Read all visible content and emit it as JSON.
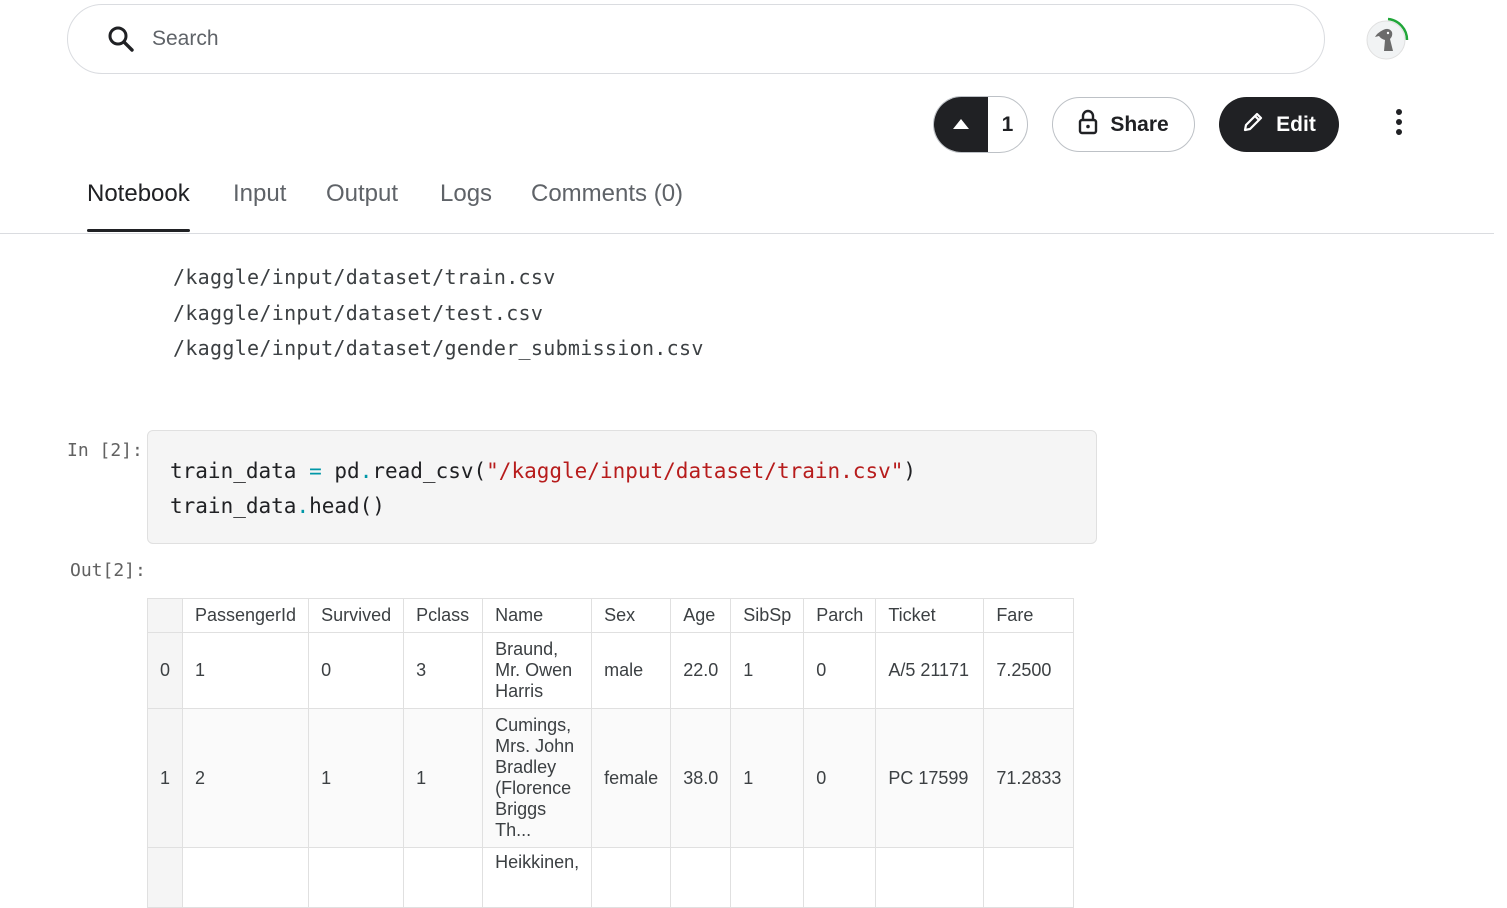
{
  "search": {
    "placeholder": "Search"
  },
  "actions": {
    "vote_count": "1",
    "share_label": "Share",
    "edit_label": "Edit"
  },
  "tabs": [
    {
      "label": "Notebook",
      "active": true
    },
    {
      "label": "Input"
    },
    {
      "label": "Output"
    },
    {
      "label": "Logs"
    },
    {
      "label": "Comments (0)"
    }
  ],
  "stdout_lines": [
    "/kaggle/input/dataset/train.csv",
    "/kaggle/input/dataset/test.csv",
    "/kaggle/input/dataset/gender_submission.csv"
  ],
  "cell": {
    "in_prompt": "In [2]:",
    "out_prompt": "Out[2]:",
    "code": {
      "line1_var": "train_data",
      "line1_eq": "=",
      "line1_call_a": "pd",
      "line1_dot": ".",
      "line1_call_b": "read_csv(",
      "line1_str": "\"/kaggle/input/dataset/train.csv\"",
      "line1_close": ")",
      "line2_var": "train_data",
      "line2_dot": ".",
      "line2_call": "head()"
    }
  },
  "table": {
    "columns": [
      "",
      "PassengerId",
      "Survived",
      "Pclass",
      "Name",
      "Sex",
      "Age",
      "SibSp",
      "Parch",
      "Ticket",
      "Fare"
    ],
    "rows": [
      [
        "0",
        "1",
        "0",
        "3",
        "Braund, Mr. Owen Harris",
        "male",
        "22.0",
        "1",
        "0",
        "A/5 21171",
        "7.2500"
      ],
      [
        "1",
        "2",
        "1",
        "1",
        "Cumings, Mrs. John Bradley (Florence Briggs Th...",
        "female",
        "38.0",
        "1",
        "0",
        "PC 17599",
        "71.2833"
      ],
      [
        "",
        "",
        "",
        "",
        "Heikkinen,",
        "",
        "",
        "",
        "",
        "",
        ""
      ]
    ]
  },
  "colors": {
    "accent_dark": "#202124",
    "string": "#b71c1c",
    "operator": "#0097a7",
    "progress_ring": "#20a639"
  },
  "icons": [
    "search-icon",
    "caret-up-icon",
    "lock-icon",
    "pencil-icon",
    "more-vert-icon",
    "avatar-duck"
  ]
}
